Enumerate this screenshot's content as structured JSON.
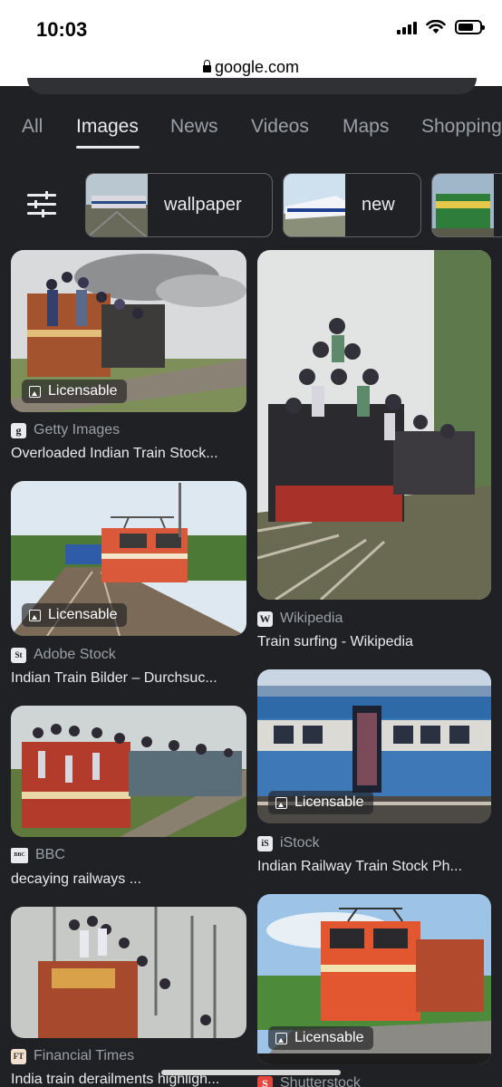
{
  "status_bar": {
    "time": "10:03"
  },
  "browser": {
    "url": "google.com"
  },
  "tabs": [
    {
      "label": "All",
      "active": false
    },
    {
      "label": "Images",
      "active": true
    },
    {
      "label": "News",
      "active": false
    },
    {
      "label": "Videos",
      "active": false
    },
    {
      "label": "Maps",
      "active": false
    },
    {
      "label": "Shopping",
      "active": false
    }
  ],
  "chips": [
    {
      "label": "wallpaper"
    },
    {
      "label": "new"
    },
    {
      "label": ""
    }
  ],
  "results": [
    {
      "source": "Getty Images",
      "favicon": "g",
      "title": "Overloaded Indian Train Stock...",
      "badge": "Licensable"
    },
    {
      "source": "Wikipedia",
      "favicon": "W",
      "title": "Train surfing - Wikipedia",
      "badge": ""
    },
    {
      "source": "Adobe Stock",
      "favicon": "St",
      "title": "Indian Train Bilder – Durchsuc...",
      "badge": "Licensable"
    },
    {
      "source": "iStock",
      "favicon": "iS",
      "title": "Indian Railway Train Stock Ph...",
      "badge": "Licensable"
    },
    {
      "source": "BBC",
      "favicon": "BBC",
      "title": "decaying railways ...",
      "badge": ""
    },
    {
      "source": "Financial Times",
      "favicon": "FT",
      "title": "India train derailments highligh...",
      "badge": ""
    },
    {
      "source": "Shutterstock",
      "favicon": "S",
      "title": "",
      "badge": "Licensable"
    }
  ],
  "colors": {
    "background": "#202124",
    "text": "#e8eaed",
    "muted": "#9aa0a6"
  }
}
